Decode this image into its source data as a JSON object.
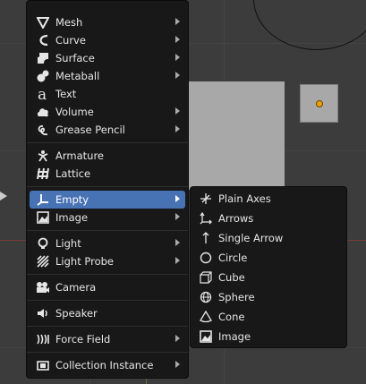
{
  "colors": {
    "menu_bg": "#181818",
    "highlight": "#4772b3",
    "text": "#e6e6e6",
    "viewport_bg": "#3c3c3c",
    "x_axis": "#7a3a3a",
    "origin": "#f0a000"
  },
  "add_menu": {
    "items": [
      {
        "label": "Mesh",
        "icon": "mesh-cone-icon",
        "submenu": true
      },
      {
        "label": "Curve",
        "icon": "curve-icon",
        "submenu": true
      },
      {
        "label": "Surface",
        "icon": "surface-icon",
        "submenu": true
      },
      {
        "label": "Metaball",
        "icon": "metaball-icon",
        "submenu": true
      },
      {
        "label": "Text",
        "icon": "text-icon",
        "submenu": false
      },
      {
        "label": "Volume",
        "icon": "volume-icon",
        "submenu": true
      },
      {
        "label": "Grease Pencil",
        "icon": "grease-pencil-icon",
        "submenu": true
      },
      {
        "label": "Armature",
        "icon": "armature-icon",
        "submenu": false
      },
      {
        "label": "Lattice",
        "icon": "lattice-icon",
        "submenu": false
      },
      {
        "label": "Empty",
        "icon": "empty-icon",
        "submenu": true,
        "active": true
      },
      {
        "label": "Image",
        "icon": "image-icon",
        "submenu": true
      },
      {
        "label": "Light",
        "icon": "light-icon",
        "submenu": true
      },
      {
        "label": "Light Probe",
        "icon": "light-probe-icon",
        "submenu": true
      },
      {
        "label": "Camera",
        "icon": "camera-icon",
        "submenu": false
      },
      {
        "label": "Speaker",
        "icon": "speaker-icon",
        "submenu": false
      },
      {
        "label": "Force Field",
        "icon": "force-field-icon",
        "submenu": true
      },
      {
        "label": "Collection Instance",
        "icon": "collection-icon",
        "submenu": true
      }
    ]
  },
  "empty_submenu": {
    "items": [
      {
        "label": "Plain Axes",
        "icon": "plain-axes-icon"
      },
      {
        "label": "Arrows",
        "icon": "arrows-icon"
      },
      {
        "label": "Single Arrow",
        "icon": "single-arrow-icon"
      },
      {
        "label": "Circle",
        "icon": "circle-icon"
      },
      {
        "label": "Cube",
        "icon": "cube-icon"
      },
      {
        "label": "Sphere",
        "icon": "sphere-icon"
      },
      {
        "label": "Cone",
        "icon": "cone-icon"
      },
      {
        "label": "Image",
        "icon": "image-icon"
      }
    ]
  }
}
